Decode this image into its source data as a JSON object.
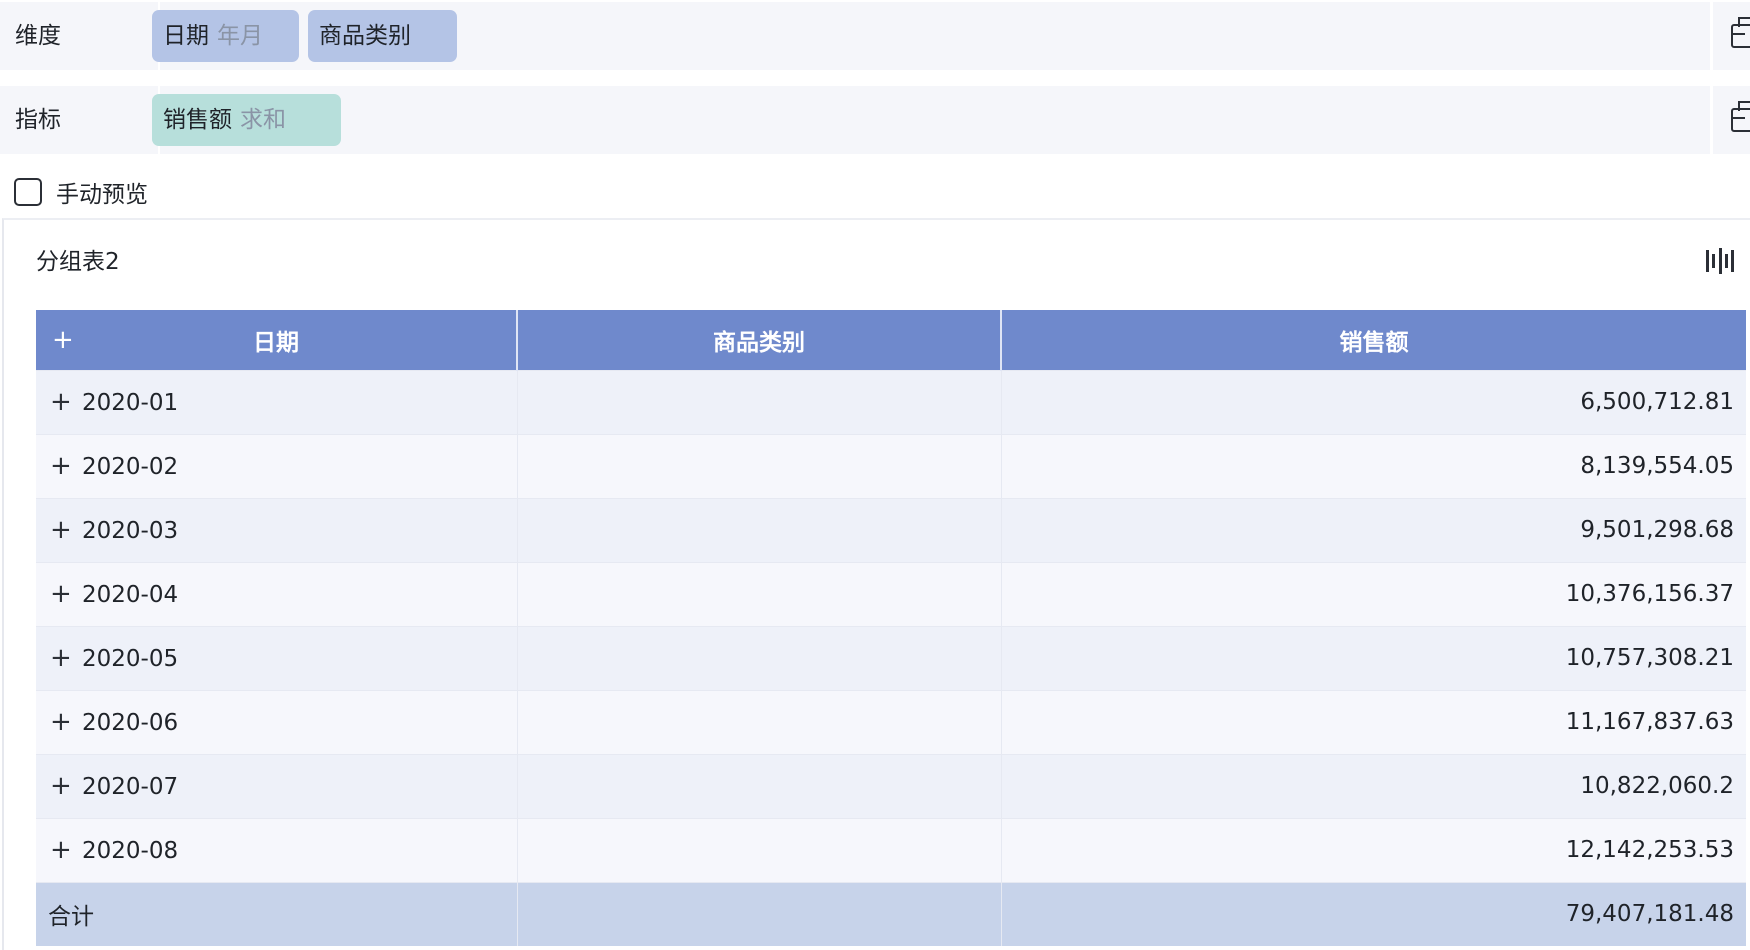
{
  "config": {
    "dimension": {
      "label": "维度",
      "fields": [
        {
          "name": "日期",
          "sub": "年月"
        },
        {
          "name": "商品类别",
          "sub": ""
        }
      ]
    },
    "metric": {
      "label": "指标",
      "fields": [
        {
          "name": "销售额",
          "sub": "求和"
        }
      ]
    },
    "manual_preview": {
      "label": "手动预览",
      "checked": false
    }
  },
  "panel": {
    "title": "分组表2",
    "table": {
      "expand_all": "+",
      "columns": [
        "日期",
        "商品类别",
        "销售额"
      ],
      "rows": [
        {
          "date": "2020-01",
          "category": "",
          "sales": "6,500,712.81"
        },
        {
          "date": "2020-02",
          "category": "",
          "sales": "8,139,554.05"
        },
        {
          "date": "2020-03",
          "category": "",
          "sales": "9,501,298.68"
        },
        {
          "date": "2020-04",
          "category": "",
          "sales": "10,376,156.37"
        },
        {
          "date": "2020-05",
          "category": "",
          "sales": "10,757,308.21"
        },
        {
          "date": "2020-06",
          "category": "",
          "sales": "11,167,837.63"
        },
        {
          "date": "2020-07",
          "category": "",
          "sales": "10,822,060.2"
        },
        {
          "date": "2020-08",
          "category": "",
          "sales": "12,142,253.53"
        }
      ],
      "row_expand": "+",
      "total": {
        "label": "合计",
        "sales": "79,407,181.48"
      }
    }
  },
  "colors": {
    "header_bg": "#6f89cc",
    "dimension_pill": "#b4c4e6",
    "metric_pill": "#b7dfdb",
    "total_row": "#c7d3ea"
  }
}
